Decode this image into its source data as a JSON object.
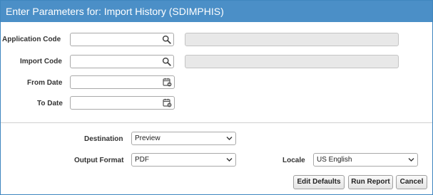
{
  "dialog": {
    "title": "Enter Parameters for: Import History (SDIMPHIS)"
  },
  "params": {
    "application_code": {
      "label": "Application Code",
      "value": "",
      "icon": "search-icon"
    },
    "import_code": {
      "label": "Import Code",
      "value": "",
      "icon": "search-icon"
    },
    "from_date": {
      "label": "From Date",
      "value": "",
      "icon": "calendar-icon"
    },
    "to_date": {
      "label": "To Date",
      "value": "",
      "icon": "calendar-icon"
    }
  },
  "output": {
    "destination": {
      "label": "Destination",
      "value": "Preview"
    },
    "output_format": {
      "label": "Output Format",
      "value": "PDF"
    },
    "locale": {
      "label": "Locale",
      "value": "US English"
    }
  },
  "buttons": {
    "edit_defaults": "Edit Defaults",
    "run_report": "Run Report",
    "cancel": "Cancel"
  },
  "colors": {
    "titlebar": "#4b8fc7",
    "border": "#3f86bf"
  }
}
